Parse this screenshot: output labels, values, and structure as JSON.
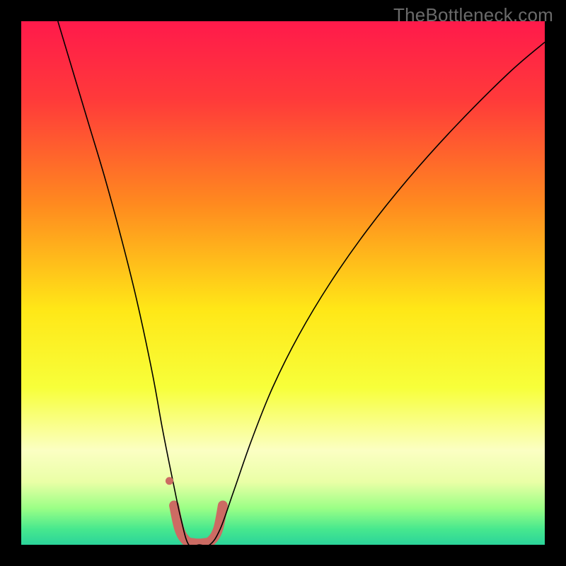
{
  "watermark": "TheBottleneck.com",
  "chart_data": {
    "type": "line",
    "title": "",
    "xlabel": "",
    "ylabel": "",
    "xlim": [
      0,
      100
    ],
    "ylim": [
      0,
      100
    ],
    "grid": false,
    "legend": false,
    "background_gradient": {
      "stops": [
        {
          "offset": 0.0,
          "color": "#ff1a4b"
        },
        {
          "offset": 0.15,
          "color": "#ff3a3a"
        },
        {
          "offset": 0.35,
          "color": "#ff8a1f"
        },
        {
          "offset": 0.55,
          "color": "#ffe717"
        },
        {
          "offset": 0.7,
          "color": "#f7ff3a"
        },
        {
          "offset": 0.82,
          "color": "#fbffc3"
        },
        {
          "offset": 0.88,
          "color": "#eaffa6"
        },
        {
          "offset": 0.93,
          "color": "#9bff86"
        },
        {
          "offset": 0.97,
          "color": "#47e88e"
        },
        {
          "offset": 1.0,
          "color": "#2bd49a"
        }
      ]
    },
    "series": [
      {
        "name": "curve",
        "type": "line",
        "color": "#000000",
        "width": 1.6,
        "x": [
          7,
          10,
          13,
          16,
          19,
          22,
          25,
          27,
          29,
          30.5,
          32,
          34,
          36,
          38,
          40.5,
          44,
          48,
          53,
          59,
          66,
          74,
          83,
          93,
          100
        ],
        "y": [
          100,
          90,
          80,
          70,
          59,
          47,
          33,
          22,
          12,
          5,
          0,
          0,
          0,
          3,
          10,
          20,
          30,
          40,
          50,
          60,
          70,
          80,
          90,
          96
        ]
      },
      {
        "name": "highlight-band",
        "type": "line",
        "color": "#cc6b63",
        "width": 14,
        "cap": "round",
        "x": [
          29.2,
          30.2,
          31.5,
          33.0,
          34.8,
          36.3,
          37.6,
          38.5
        ],
        "y": [
          7.5,
          3.0,
          0.8,
          0.3,
          0.3,
          0.8,
          3.0,
          7.5
        ]
      },
      {
        "name": "marker-dot",
        "type": "scatter",
        "color": "#cc6b63",
        "size": 11,
        "x": [
          28.3
        ],
        "y": [
          12.2
        ]
      }
    ]
  }
}
